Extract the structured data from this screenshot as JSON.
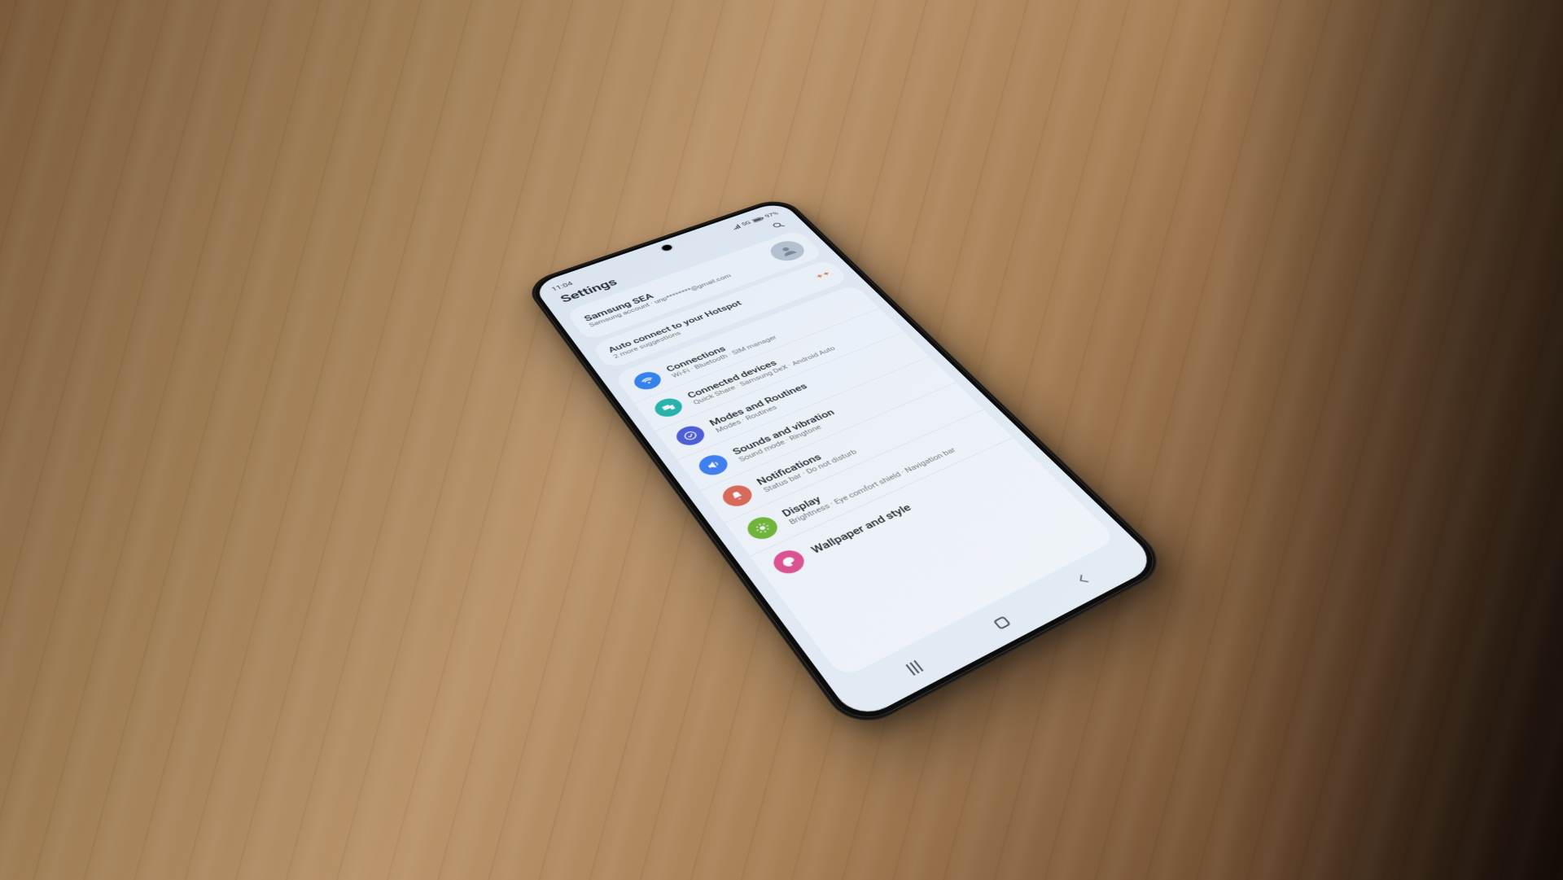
{
  "status": {
    "time": "11:04",
    "network": "5G",
    "battery": "97%"
  },
  "header": {
    "title": "Settings"
  },
  "account": {
    "name": "Samsung SEA",
    "sub": "Samsung account · unp********@gmail.com"
  },
  "suggestion": {
    "title": "Auto connect to your Hotspot",
    "sub": "2 more suggestions"
  },
  "items": [
    {
      "title": "Connections",
      "sub": "Wi-Fi · Bluetooth · SIM manager",
      "color": "#2e7ef0",
      "icon": "wifi"
    },
    {
      "title": "Connected devices",
      "sub": "Quick Share · Samsung DeX · Android Auto",
      "color": "#1fb3a6",
      "icon": "devices"
    },
    {
      "title": "Modes and Routines",
      "sub": "Modes · Routines",
      "color": "#4a55d6",
      "icon": "check"
    },
    {
      "title": "Sounds and vibration",
      "sub": "Sound mode · Ringtone",
      "color": "#3a7bf0",
      "icon": "sound"
    },
    {
      "title": "Notifications",
      "sub": "Status bar · Do not disturb",
      "color": "#e0644e",
      "icon": "bell"
    },
    {
      "title": "Display",
      "sub": "Brightness · Eye comfort shield · Navigation bar",
      "color": "#6fb52e",
      "icon": "sun"
    },
    {
      "title": "Wallpaper and style",
      "sub": "",
      "color": "#e24a8c",
      "icon": "palette"
    }
  ]
}
